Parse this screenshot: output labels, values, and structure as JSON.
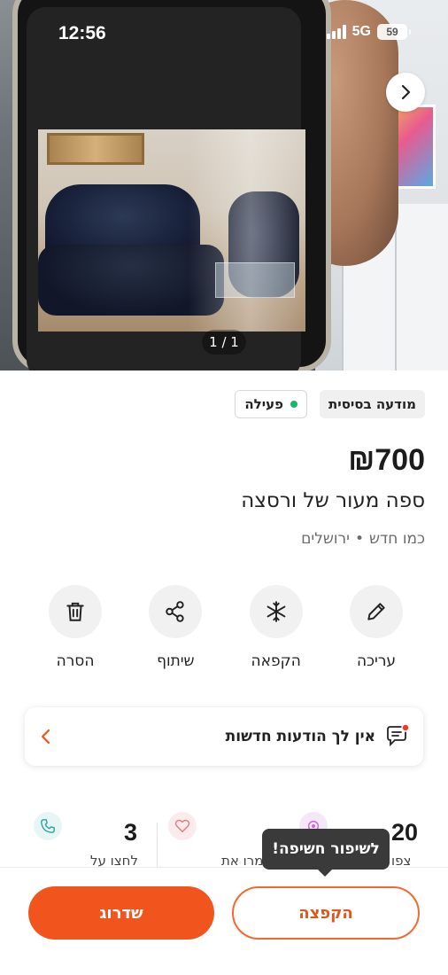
{
  "status_bar": {
    "time": "12:56",
    "network": "5G",
    "battery": "59"
  },
  "gallery": {
    "counter": "1 / 1",
    "next_icon": "chevron-right-icon"
  },
  "listing": {
    "type_badge": "מודעה בסיסית",
    "status_badge": "פעילה",
    "status_color": "#18b86a",
    "price": "₪700",
    "title": "ספה מעור של ורסצה",
    "condition": "כמו חדש",
    "separator": "•",
    "location": "ירושלים"
  },
  "actions": [
    {
      "label": "עריכה",
      "icon": "pencil-icon"
    },
    {
      "label": "הקפאה",
      "icon": "snowflake-icon"
    },
    {
      "label": "שיתוף",
      "icon": "share-icon"
    },
    {
      "label": "הסרה",
      "icon": "trash-icon"
    }
  ],
  "messages": {
    "text": "אין לך הודעות חדשות",
    "icon": "chat-icon"
  },
  "stats": [
    {
      "value": "20",
      "label": "צפו",
      "icon": "eye-icon",
      "icon_color": "#c86bd6"
    },
    {
      "value": "",
      "label": "שמרו את",
      "icon": "heart-icon",
      "icon_color": "#e07d86"
    },
    {
      "value": "3",
      "label": "לחצו על",
      "icon": "phone-icon",
      "icon_color": "#2fa3a0"
    }
  ],
  "tooltip": {
    "text": "לשיפור חשיפה!"
  },
  "bottom": {
    "freeze_label": "הקפצה",
    "upgrade_label": "שדרוג",
    "accent": "#f2541d"
  }
}
